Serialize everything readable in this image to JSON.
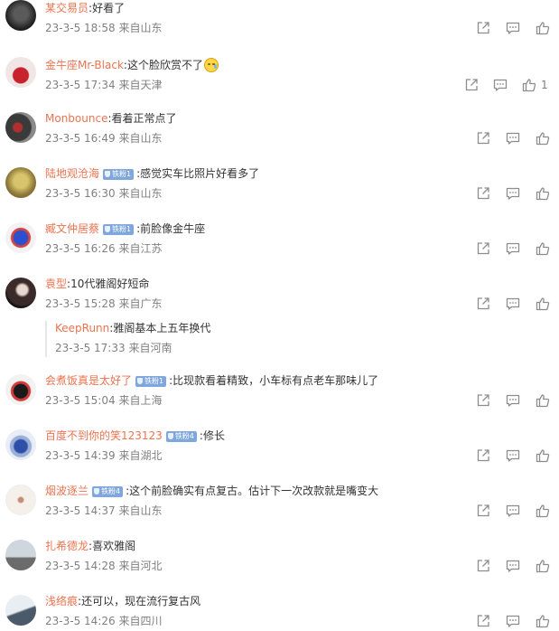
{
  "icons": {
    "forward": "forward-icon",
    "comment": "comment-icon",
    "like": "like-icon"
  },
  "colors": {
    "username": "#eb7350",
    "meta": "#808080",
    "badge": "#7fa7db",
    "icon": "#8d8d8d"
  },
  "comments": [
    {
      "user": "某交易员",
      "badge": "",
      "text": "好看了",
      "emoji": false,
      "time": "23-3-5 18:58",
      "location": "来自山东",
      "likes": "",
      "reply": null
    },
    {
      "user": "金牛座Mr-Black",
      "badge": "",
      "text": "这个脸欣赏不了",
      "emoji": true,
      "time": "23-3-5 17:34",
      "location": "来自天津",
      "likes": "1",
      "reply": null
    },
    {
      "user": "Monbounce",
      "badge": "",
      "text": "看着正常点了",
      "emoji": false,
      "time": "23-3-5 16:49",
      "location": "来自山东",
      "likes": "",
      "reply": null
    },
    {
      "user": "陆地观沧海",
      "badge": "铁粉1",
      "text": "感觉实车比照片好看多了",
      "emoji": false,
      "time": "23-3-5 16:30",
      "location": "来自山东",
      "likes": "",
      "reply": null
    },
    {
      "user": "臧文仲居蔡",
      "badge": "铁粉1",
      "text": "前脸像金牛座",
      "emoji": false,
      "time": "23-3-5 16:26",
      "location": "来自江苏",
      "likes": "",
      "reply": null
    },
    {
      "user": "袁型",
      "badge": "",
      "text": "10代雅阁好短命",
      "emoji": false,
      "time": "23-3-5 15:28",
      "location": "来自广东",
      "likes": "",
      "reply": {
        "user": "KeepRunn",
        "text": "雅阁基本上五年换代",
        "time": "23-3-5 17:33",
        "location": "来自河南"
      }
    },
    {
      "user": "会煮饭真是太好了",
      "badge": "铁粉1",
      "text": "比现款看着精致，小车标有点老车那味儿了",
      "emoji": false,
      "time": "23-3-5 15:04",
      "location": "来自上海",
      "likes": "",
      "reply": null
    },
    {
      "user": "百度不到你的笑123123",
      "badge": "铁粉4",
      "text": "修长",
      "emoji": false,
      "time": "23-3-5 14:39",
      "location": "来自湖北",
      "likes": "",
      "reply": null
    },
    {
      "user": "烟波逐兰",
      "badge": "铁粉4",
      "text": "这个前脸确实有点复古。估计下一次改款就是嘴变大",
      "emoji": false,
      "time": "23-3-5 14:37",
      "location": "来自山东",
      "likes": "",
      "reply": null
    },
    {
      "user": "扎希德龙",
      "badge": "",
      "text": "喜欢雅阁",
      "emoji": false,
      "time": "23-3-5 14:28",
      "location": "来自河北",
      "likes": "",
      "reply": null
    },
    {
      "user": "浅络痕",
      "badge": "",
      "text": "还可以，现在流行复古风",
      "emoji": false,
      "time": "23-3-5 14:26",
      "location": "来自四川",
      "likes": "",
      "reply": null
    }
  ]
}
